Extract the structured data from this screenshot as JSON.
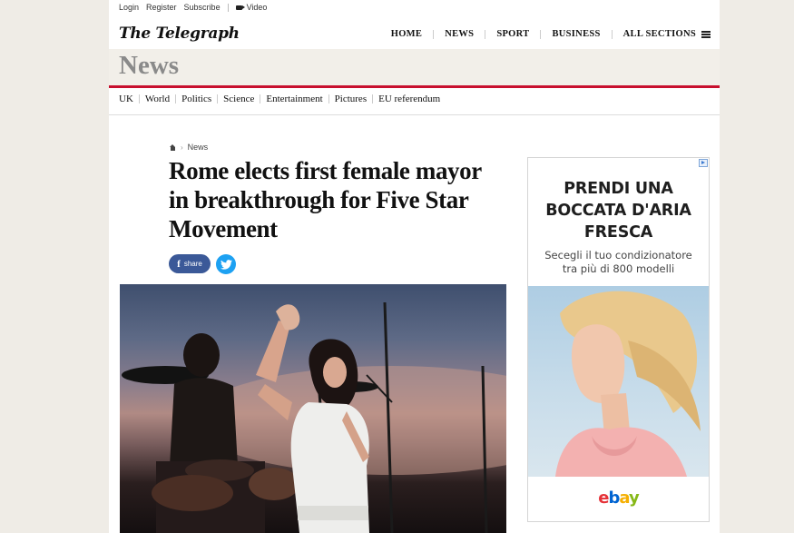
{
  "utility": {
    "login": "Login",
    "register": "Register",
    "subscribe": "Subscribe",
    "video": "Video"
  },
  "logo": "The Telegraph",
  "main_nav": {
    "home": "HOME",
    "news": "NEWS",
    "sport": "SPORT",
    "business": "BUSINESS",
    "all_sections": "ALL SECTIONS"
  },
  "section_title": "News",
  "sub_nav": [
    "UK",
    "World",
    "Politics",
    "Science",
    "Entertainment",
    "Pictures",
    "EU referendum"
  ],
  "breadcrumb": {
    "current": "News"
  },
  "article": {
    "headline": "Rome elects first female mayor in breakthrough for Five Star Movement",
    "share_label": "share"
  },
  "ad": {
    "headline_lines": [
      "PRENDI UNA",
      "BOCCATA D'ARIA",
      "FRESCA"
    ],
    "sub_lines": [
      "Secegli il tuo condizionatore",
      "tra più di 800 modelli"
    ],
    "brand": [
      "e",
      "b",
      "a",
      "y"
    ]
  },
  "colors": {
    "accent_red": "#c8102e",
    "facebook": "#3b5998",
    "twitter": "#1da1f2"
  }
}
